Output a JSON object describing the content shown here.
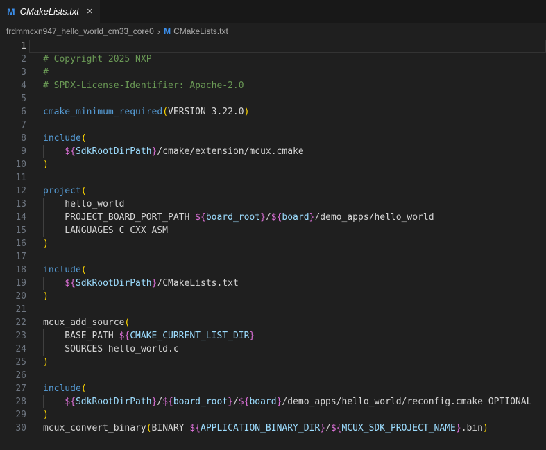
{
  "tab": {
    "label": "CMakeLists.txt",
    "file_icon_glyph": "M",
    "close_glyph": "×"
  },
  "breadcrumb": {
    "folder": "frdmmcxn947_hello_world_cm33_core0",
    "separator_glyph": "›",
    "file_icon_glyph": "M",
    "file": "CMakeLists.txt"
  },
  "colors": {
    "editor_bg": "#1f1f1f",
    "tabbar_bg": "#181818",
    "active_tab_bg": "#1f1f1f",
    "comment": "#6a9955",
    "command": "#569cd6",
    "variable": "#9cdcfe",
    "brace": "#da70d6",
    "paren": "#ffd700",
    "plain_text": "#d4d4d4",
    "line_number": "#6e7681",
    "active_line_number": "#c6c6c6",
    "file_icon_blue": "#3b8eea"
  },
  "editor": {
    "language": "cmake",
    "lines": [
      {
        "num": 1,
        "current": true,
        "segments": []
      },
      {
        "num": 2,
        "segments": [
          [
            "com",
            "# Copyright 2025 NXP"
          ]
        ]
      },
      {
        "num": 3,
        "segments": [
          [
            "com",
            "#"
          ]
        ]
      },
      {
        "num": 4,
        "segments": [
          [
            "com",
            "# SPDX-License-Identifier: Apache-2.0"
          ]
        ]
      },
      {
        "num": 5,
        "segments": []
      },
      {
        "num": 6,
        "segments": [
          [
            "cmd",
            "cmake_minimum_required"
          ],
          [
            "par",
            "("
          ],
          [
            "txt",
            "VERSION 3.22.0"
          ],
          [
            "par",
            ")"
          ]
        ]
      },
      {
        "num": 7,
        "segments": []
      },
      {
        "num": 8,
        "segments": [
          [
            "cmd",
            "include"
          ],
          [
            "par",
            "("
          ]
        ]
      },
      {
        "num": 9,
        "guide": true,
        "segments": [
          [
            "txt",
            "    "
          ],
          [
            "brc",
            "${"
          ],
          [
            "var",
            "SdkRootDirPath"
          ],
          [
            "brc",
            "}"
          ],
          [
            "txt",
            "/cmake/extension/mcux.cmake"
          ]
        ]
      },
      {
        "num": 10,
        "segments": [
          [
            "par",
            ")"
          ]
        ]
      },
      {
        "num": 11,
        "segments": []
      },
      {
        "num": 12,
        "segments": [
          [
            "cmd",
            "project"
          ],
          [
            "par",
            "("
          ]
        ]
      },
      {
        "num": 13,
        "guide": true,
        "segments": [
          [
            "txt",
            "    hello_world"
          ]
        ]
      },
      {
        "num": 14,
        "guide": true,
        "segments": [
          [
            "txt",
            "    PROJECT_BOARD_PORT_PATH "
          ],
          [
            "brc",
            "${"
          ],
          [
            "var",
            "board_root"
          ],
          [
            "brc",
            "}"
          ],
          [
            "txt",
            "/"
          ],
          [
            "brc",
            "${"
          ],
          [
            "var",
            "board"
          ],
          [
            "brc",
            "}"
          ],
          [
            "txt",
            "/demo_apps/hello_world"
          ]
        ]
      },
      {
        "num": 15,
        "guide": true,
        "segments": [
          [
            "txt",
            "    LANGUAGES C CXX ASM"
          ]
        ]
      },
      {
        "num": 16,
        "segments": [
          [
            "par",
            ")"
          ]
        ]
      },
      {
        "num": 17,
        "segments": []
      },
      {
        "num": 18,
        "segments": [
          [
            "cmd",
            "include"
          ],
          [
            "par",
            "("
          ]
        ]
      },
      {
        "num": 19,
        "guide": true,
        "segments": [
          [
            "txt",
            "    "
          ],
          [
            "brc",
            "${"
          ],
          [
            "var",
            "SdkRootDirPath"
          ],
          [
            "brc",
            "}"
          ],
          [
            "txt",
            "/CMakeLists.txt"
          ]
        ]
      },
      {
        "num": 20,
        "segments": [
          [
            "par",
            ")"
          ]
        ]
      },
      {
        "num": 21,
        "segments": []
      },
      {
        "num": 22,
        "segments": [
          [
            "txt",
            "mcux_add_source"
          ],
          [
            "par",
            "("
          ]
        ]
      },
      {
        "num": 23,
        "guide": true,
        "segments": [
          [
            "txt",
            "    BASE_PATH "
          ],
          [
            "brc",
            "${"
          ],
          [
            "var",
            "CMAKE_CURRENT_LIST_DIR"
          ],
          [
            "brc",
            "}"
          ]
        ]
      },
      {
        "num": 24,
        "guide": true,
        "segments": [
          [
            "txt",
            "    SOURCES hello_world.c"
          ]
        ]
      },
      {
        "num": 25,
        "segments": [
          [
            "par",
            ")"
          ]
        ]
      },
      {
        "num": 26,
        "segments": []
      },
      {
        "num": 27,
        "segments": [
          [
            "cmd",
            "include"
          ],
          [
            "par",
            "("
          ]
        ]
      },
      {
        "num": 28,
        "guide": true,
        "segments": [
          [
            "txt",
            "    "
          ],
          [
            "brc",
            "${"
          ],
          [
            "var",
            "SdkRootDirPath"
          ],
          [
            "brc",
            "}"
          ],
          [
            "txt",
            "/"
          ],
          [
            "brc",
            "${"
          ],
          [
            "var",
            "board_root"
          ],
          [
            "brc",
            "}"
          ],
          [
            "txt",
            "/"
          ],
          [
            "brc",
            "${"
          ],
          [
            "var",
            "board"
          ],
          [
            "brc",
            "}"
          ],
          [
            "txt",
            "/demo_apps/hello_world/reconfig.cmake OPTIONAL"
          ]
        ]
      },
      {
        "num": 29,
        "segments": [
          [
            "par",
            ")"
          ]
        ]
      },
      {
        "num": 30,
        "segments": [
          [
            "txt",
            "mcux_convert_binary"
          ],
          [
            "par",
            "("
          ],
          [
            "txt",
            "BINARY "
          ],
          [
            "brc",
            "${"
          ],
          [
            "var",
            "APPLICATION_BINARY_DIR"
          ],
          [
            "brc",
            "}"
          ],
          [
            "txt",
            "/"
          ],
          [
            "brc",
            "${"
          ],
          [
            "var",
            "MCUX_SDK_PROJECT_NAME"
          ],
          [
            "brc",
            "}"
          ],
          [
            "txt",
            ".bin"
          ],
          [
            "par",
            ")"
          ]
        ]
      }
    ]
  }
}
